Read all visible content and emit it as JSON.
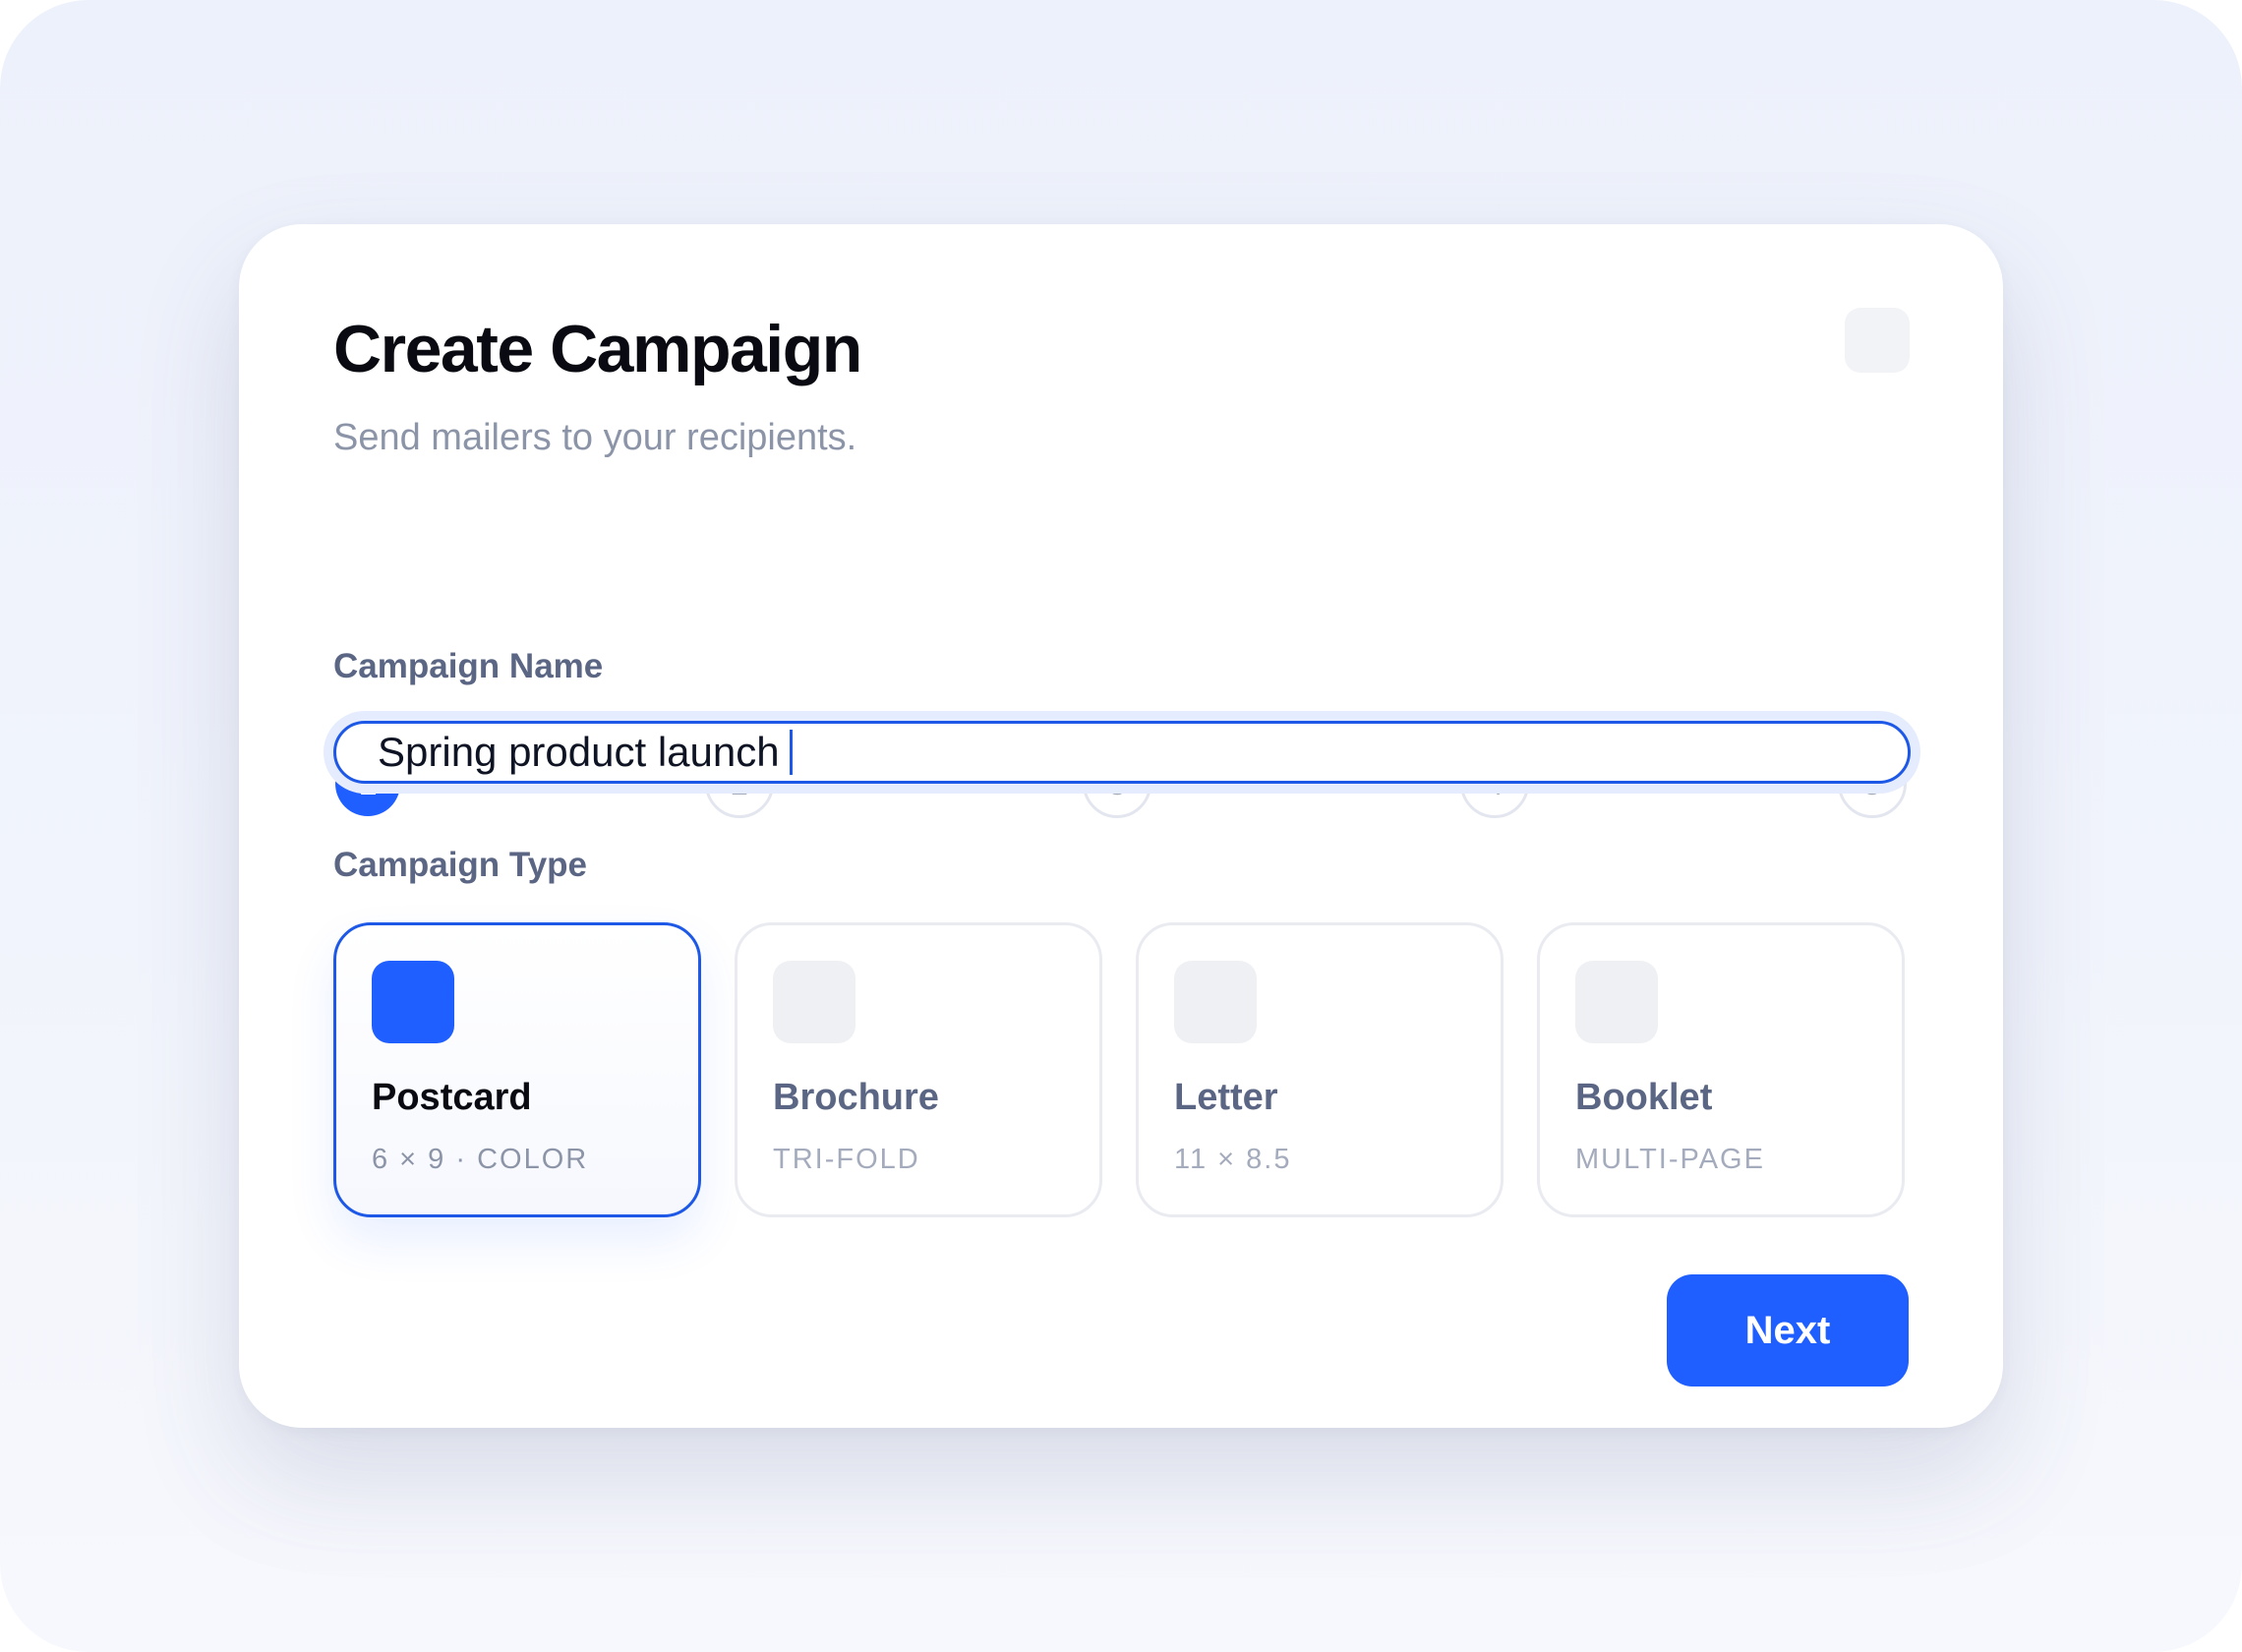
{
  "dialog": {
    "title": "Create Campaign",
    "subtitle": "Send mailers to your recipients."
  },
  "stepper": {
    "current": 1,
    "steps": [
      "1",
      "2",
      "3",
      "4",
      "5"
    ]
  },
  "form": {
    "name_label": "Campaign Name",
    "name_value": "Spring product launch",
    "type_label": "Campaign Type",
    "types": [
      {
        "name": "Postcard",
        "detail": "6 × 9 · COLOR",
        "selected": true
      },
      {
        "name": "Brochure",
        "detail": "TRI-FOLD",
        "selected": false
      },
      {
        "name": "Letter",
        "detail": "11 × 8.5",
        "selected": false
      },
      {
        "name": "Booklet",
        "detail": "MULTI-PAGE",
        "selected": false
      }
    ]
  },
  "actions": {
    "next_label": "Next"
  },
  "colors": {
    "accent": "#1f5eff",
    "background": "#eef2fb",
    "title_text": "#0a0b12",
    "muted_text": "#8c94a8"
  }
}
